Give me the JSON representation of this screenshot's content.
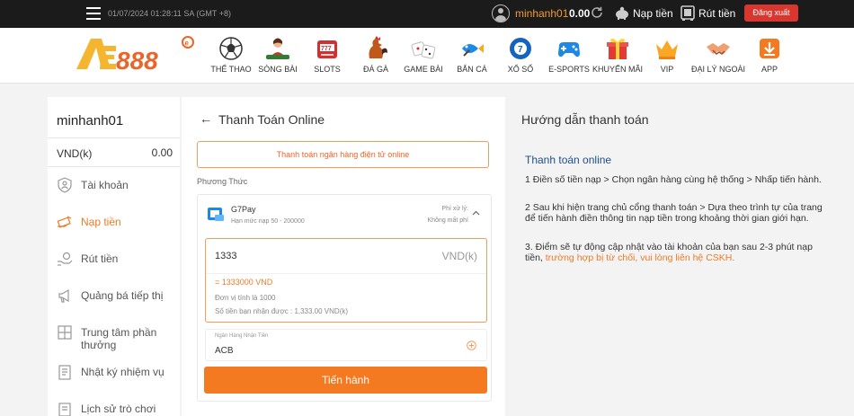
{
  "topbar": {
    "datetime": "01/07/2024 01:28:11 SA (GMT +8)",
    "username": "minhanh01",
    "balance": "0.00",
    "deposit_label": "Nạp tiền",
    "withdraw_label": "Rút tiền",
    "logout_label": "Đăng xuất",
    "accent_color": "#f39b2b",
    "logout_color": "#d7372e"
  },
  "header": {
    "logo_text": "AE888",
    "nav": [
      {
        "label": "THỂ THAO",
        "icon": "soccer-ball-icon"
      },
      {
        "label": "SÒNG BÀI",
        "icon": "casino-dealer-icon"
      },
      {
        "label": "SLOTS",
        "icon": "slot-machine-icon"
      },
      {
        "label": "ĐÁ GÀ",
        "icon": "rooster-icon"
      },
      {
        "label": "GAME BÀI",
        "icon": "dice-icon"
      },
      {
        "label": "BẮN CÁ",
        "icon": "fish-icon"
      },
      {
        "label": "XỔ SỐ",
        "icon": "lottery-ball-icon"
      },
      {
        "label": "E-SPORTS",
        "icon": "gamepad-icon"
      },
      {
        "label": "KHUYẾN MÃI",
        "icon": "gift-icon"
      },
      {
        "label": "VIP",
        "icon": "crown-icon"
      },
      {
        "label": "ĐẠI LÝ NGOÀI",
        "icon": "handshake-icon"
      },
      {
        "label": "APP",
        "icon": "download-icon"
      }
    ]
  },
  "sidebar": {
    "username": "minhanh01",
    "currency_label": "VND(k)",
    "balance": "0.00",
    "items": [
      {
        "label": "Tài khoản",
        "icon": "shield-user-icon",
        "active": false
      },
      {
        "label": "Nạp tiền",
        "icon": "deposit-money-icon",
        "active": true
      },
      {
        "label": "Rút tiền",
        "icon": "withdraw-hand-icon",
        "active": false
      },
      {
        "label": "Quảng bá tiếp thị",
        "icon": "megaphone-icon",
        "active": false
      },
      {
        "label": "Trung tâm phần thưởng",
        "icon": "reward-center-icon",
        "active": false
      },
      {
        "label": "Nhật ký nhiệm vụ",
        "icon": "task-log-icon",
        "active": false
      },
      {
        "label": "Lịch sử trò chơi",
        "icon": "game-history-icon",
        "active": false
      }
    ]
  },
  "payment": {
    "title": "Thanh Toán Online",
    "method_option": "Thanh toán ngân hàng điện tử online",
    "method_label": "Phương Thức",
    "provider": {
      "name": "G7Pay",
      "limit": "Hạn mức nạp 50 - 200000",
      "fee_label": "Phí xử lý:",
      "fee_value": "Không mất phí"
    },
    "amount": {
      "value": "1333",
      "unit": "VND(k)",
      "converted": "= 1333000 VND",
      "unit_info": "Đơn vị tính là 1000",
      "receive": "Số tiền bạn nhận được : 1,333.00 VND(k)"
    },
    "bank": {
      "label": "Ngân Hàng Nhận Tiền",
      "value": "ACB"
    },
    "submit_label": "Tiến hành",
    "button_color": "#f47a22"
  },
  "guide": {
    "title": "Hướng dẫn thanh toán",
    "subtitle": "Thanh toán online",
    "step1": "1 Điền số tiền nạp > Chọn ngân hàng cùng hệ thống > Nhấp tiến hành.",
    "step2": "2 Sau khi hiện trang chủ cổng thanh toán > Dựa theo trình tự của trang để tiến hành điền thông tin nạp tiền trong khoảng thời gian giới hạn.",
    "step3_text": "3. Điểm sẽ tự động cập nhật vào tài khoản của bạn sau 2-3 phút nạp tiền, ",
    "step3_highlight": "trường hợp bị từ chối, vui lòng liên hệ CSKH."
  }
}
